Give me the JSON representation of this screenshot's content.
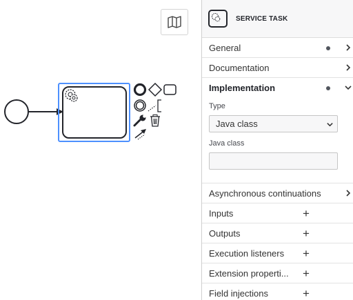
{
  "canvas": {
    "minimap_icon": "map-icon",
    "context_pad": {
      "icons": [
        "end-event-icon",
        "gateway-icon",
        "task-icon",
        "intermediate-event-icon",
        "text-annotation-icon",
        "wrench-icon",
        "trash-icon",
        "connect-icon"
      ]
    }
  },
  "panel": {
    "header": {
      "type_label": "SERVICE TASK",
      "icon": "gear-icon"
    },
    "groups": [
      {
        "label": "General",
        "has_dot": true,
        "control": "chevron-right"
      },
      {
        "label": "Documentation",
        "has_dot": false,
        "control": "chevron-right"
      },
      {
        "label": "Implementation",
        "has_dot": true,
        "control": "chevron-down"
      },
      {
        "label": "Asynchronous continuations",
        "has_dot": false,
        "control": "chevron-right"
      },
      {
        "label": "Inputs",
        "control": "plus"
      },
      {
        "label": "Outputs",
        "control": "plus"
      },
      {
        "label": "Execution listeners",
        "control": "plus"
      },
      {
        "label": "Extension properti...",
        "control": "plus"
      },
      {
        "label": "Field injections",
        "control": "plus"
      }
    ],
    "implementation": {
      "type_label": "Type",
      "type_value": "Java class",
      "java_class_label": "Java class",
      "java_class_value": ""
    }
  },
  "colors": {
    "selection": "#4d90fe",
    "stroke": "#22242a",
    "panel_header_bg": "#f7f7f8"
  }
}
